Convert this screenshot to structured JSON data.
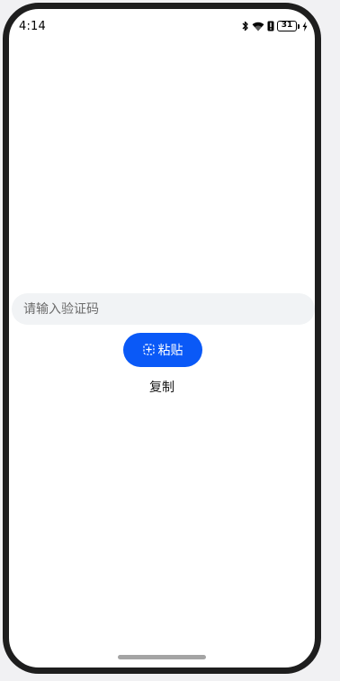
{
  "status_bar": {
    "time": "4:14",
    "battery_level": "31",
    "icons": [
      "bluetooth-icon",
      "wifi-icon",
      "alert-icon",
      "battery-icon",
      "charging-icon"
    ]
  },
  "verification": {
    "input_placeholder": "请输入验证码",
    "input_value": ""
  },
  "paste_button": {
    "label": "粘贴",
    "icon": "paste-icon"
  },
  "copy_text": "复制",
  "colors": {
    "accent": "#0a59f7",
    "input_background": "#f1f3f5",
    "frame": "#1e1e1e"
  }
}
